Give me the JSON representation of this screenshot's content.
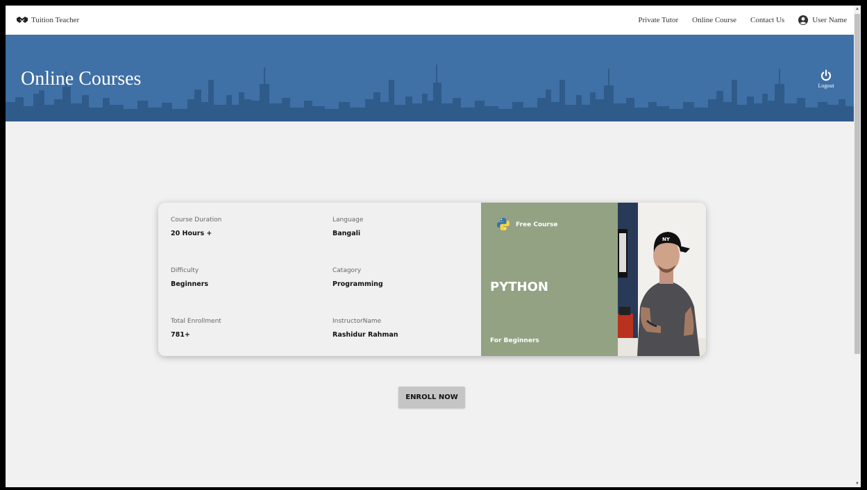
{
  "nav": {
    "brand": "Tuition Teacher",
    "links": [
      "Private Tutor",
      "Online Course",
      "Contact Us"
    ],
    "user_name": "User Name"
  },
  "banner": {
    "title": "Online Courses",
    "logout_label": "Logout"
  },
  "course": {
    "fields": [
      {
        "label": "Course Duration",
        "value": "20 Hours +"
      },
      {
        "label": "Language",
        "value": "Bangali"
      },
      {
        "label": "Difficulty",
        "value": "Beginners"
      },
      {
        "label": "Catagory",
        "value": "Programming"
      },
      {
        "label": "Total Enrollment",
        "value": "781+"
      },
      {
        "label": "InstructorName",
        "value": "Rashidur Rahman"
      }
    ],
    "promo": {
      "badge": "Free Course",
      "language": "PYTHON",
      "level": "For Beginners"
    }
  },
  "enroll_label": "ENROLL NOW",
  "colors": {
    "banner": "#3f70a6",
    "promo": "#93a283",
    "background": "#f1f1f1"
  },
  "icons": [
    "handshake-icon",
    "user-avatar-icon",
    "power-icon",
    "python-logo-icon"
  ]
}
